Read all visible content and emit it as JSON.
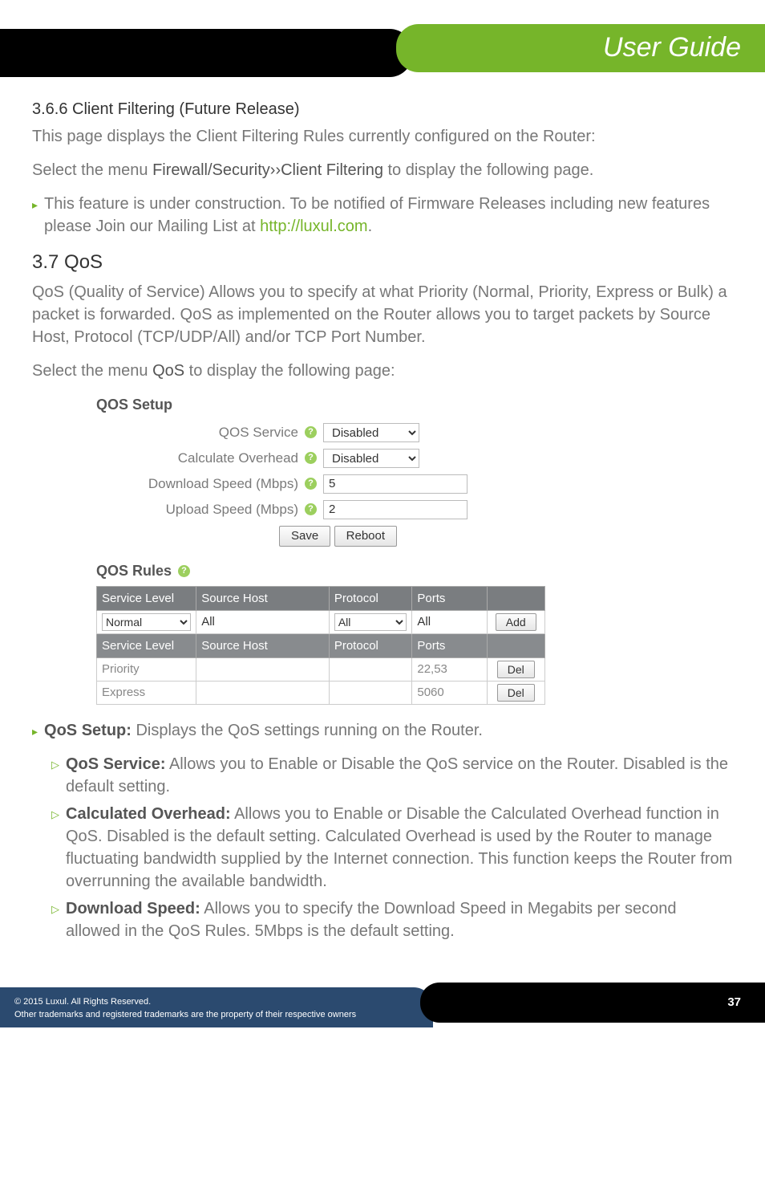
{
  "header": {
    "title": "User Guide"
  },
  "sec366": {
    "heading": "3.6.6 Client Filtering (Future Release)",
    "p1": "This page displays the Client Filtering Rules currently configured on the Router:",
    "p2_pre": "Select the menu ",
    "p2_bold": "Firewall/Security››Client Filtering",
    "p2_post": " to display the following page.",
    "bullet_pre": "This feature is under construction. To be notified of Firmware Releases including new features please Join our Mailing List at ",
    "bullet_link": "http://luxul.com",
    "bullet_post": "."
  },
  "sec37": {
    "heading": "3.7 QoS",
    "p1": "QoS (Quality of Service) Allows you to specify at what Priority (Normal, Priority, Express or Bulk) a packet is forwarded. QoS as implemented on the Router allows you to target packets by Source Host, Protocol (TCP/UDP/All) and/or TCP Port Number.",
    "p2_pre": "Select the menu ",
    "p2_bold": "QoS",
    "p2_post": " to display the following page:"
  },
  "qos_setup": {
    "title": "QOS Setup",
    "rows": {
      "service_label": "QOS Service",
      "service_value": "Disabled",
      "overhead_label": "Calculate Overhead",
      "overhead_value": "Disabled",
      "download_label": "Download Speed (Mbps)",
      "download_value": "5",
      "upload_label": "Upload Speed (Mbps)",
      "upload_value": "2"
    },
    "save_btn": "Save",
    "reboot_btn": "Reboot"
  },
  "qos_rules": {
    "title": "QOS Rules",
    "headers": {
      "service_level": "Service Level",
      "source_host": "Source Host",
      "protocol": "Protocol",
      "ports": "Ports"
    },
    "input_row": {
      "service_level": "Normal",
      "source_host": "All",
      "protocol": "All",
      "ports": "All",
      "add_btn": "Add"
    },
    "data_rows": [
      {
        "service_level": "Priority",
        "source_host": "",
        "protocol": "",
        "ports": "22,53",
        "del": "Del"
      },
      {
        "service_level": "Express",
        "source_host": "",
        "protocol": "",
        "ports": "5060",
        "del": "Del"
      }
    ]
  },
  "desc": {
    "setup_label": "QoS Setup:",
    "setup_text": " Displays the QoS settings running on the Router.",
    "service_label": "QoS Service:",
    "service_text": " Allows you to Enable or Disable the QoS service on the Router. Disabled is the default setting.",
    "overhead_label": "Calculated Overhead:",
    "overhead_text": " Allows you to Enable or Disable the Calculated Overhead function in QoS. Disabled is the default setting. Calculated Overhead is used by the Router to manage fluctuating bandwidth supplied by the Internet connection. This function keeps the Router from overrunning the available bandwidth.",
    "download_label": "Download Speed:",
    "download_text": " Allows you to specify the Download Speed in Megabits per second allowed in the QoS Rules. 5Mbps is the default setting."
  },
  "footer": {
    "line1": "© 2015  Luxul. All Rights Reserved.",
    "line2": "Other trademarks and registered trademarks are the property of their respective owners",
    "page": "37"
  }
}
